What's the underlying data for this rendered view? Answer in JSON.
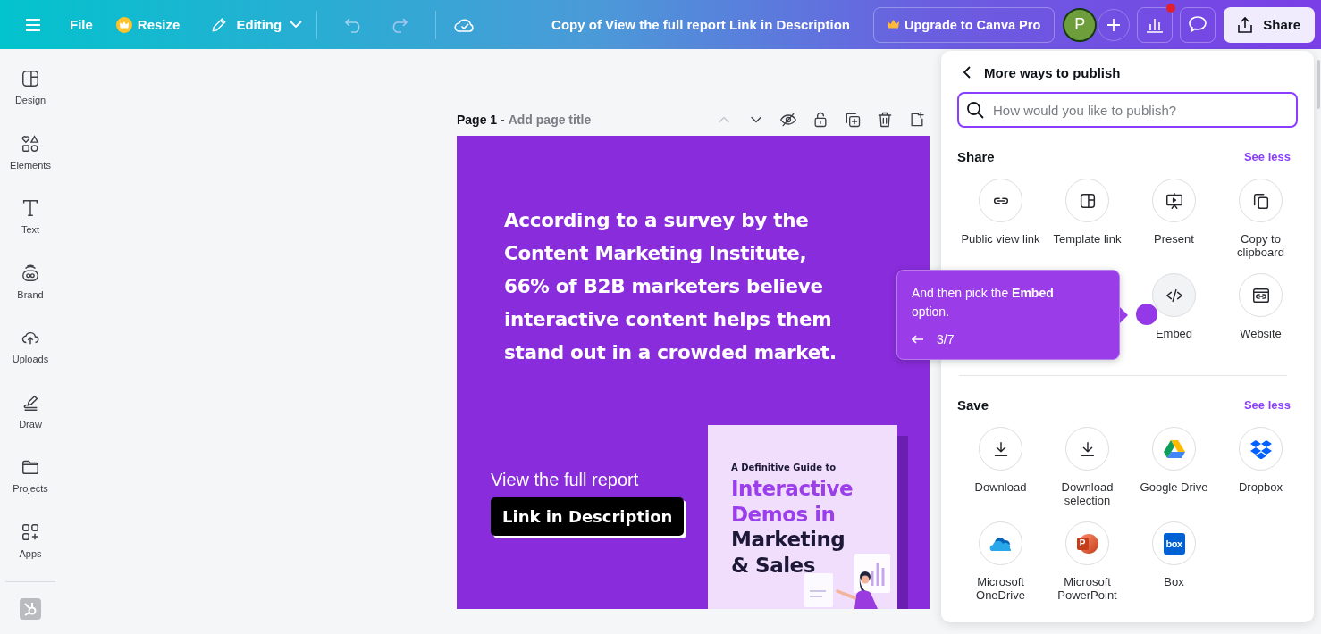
{
  "topbar": {
    "file": "File",
    "resize": "Resize",
    "mode": "Editing",
    "title": "Copy of View the full report Link in Description",
    "upgrade": "Upgrade to Canva Pro",
    "avatar": "P",
    "share": "Share",
    "has_notification": true
  },
  "sidebar": {
    "items": [
      {
        "label": "Design"
      },
      {
        "label": "Elements"
      },
      {
        "label": "Text"
      },
      {
        "label": "Brand"
      },
      {
        "label": "Uploads"
      },
      {
        "label": "Draw"
      },
      {
        "label": "Projects"
      },
      {
        "label": "Apps"
      }
    ]
  },
  "page": {
    "label": "Page 1 -",
    "title_placeholder": "Add page title",
    "tools": [
      {
        "disabled": true
      },
      {
        "disabled": false
      },
      {
        "disabled": false
      },
      {
        "disabled": false
      },
      {
        "disabled": false
      },
      {
        "disabled": false
      },
      {
        "disabled": false
      }
    ]
  },
  "slide": {
    "quote_lines": [
      "According to a survey by the",
      "Content Marketing Institute,",
      "66% of B2B marketers believe",
      "interactive content helps them",
      "stand out in a crowded market."
    ],
    "cta_label": "View the full report",
    "cta_button": "Link in Description",
    "cover": {
      "kicker": "A Definitive Guide to",
      "accent_lines": [
        "Interactive",
        "Demos in"
      ],
      "dark_lines": [
        "Marketing",
        "& Sales"
      ]
    }
  },
  "panel": {
    "title": "More ways to publish",
    "search_placeholder": "How would you like to publish?",
    "sections": [
      {
        "title": "Share",
        "link": "See less",
        "items": [
          {
            "label": "Public view link"
          },
          {
            "label": "Template link"
          },
          {
            "label": "Present"
          },
          {
            "label": "Copy to clipboard"
          },
          {
            "label": "Embed"
          },
          {
            "label": "Website"
          }
        ]
      },
      {
        "title": "Save",
        "link": "See less",
        "items": [
          {
            "label": "Download"
          },
          {
            "label": "Download selection"
          },
          {
            "label": "Google Drive"
          },
          {
            "label": "Dropbox"
          },
          {
            "label": "Microsoft OneDrive"
          },
          {
            "label": "Microsoft PowerPoint",
            "logo_text": "P"
          },
          {
            "label": "Box",
            "logo_text": "box"
          }
        ]
      }
    ]
  },
  "tooltip": {
    "text": "And then pick the **Embed** option.",
    "step": "3/7"
  }
}
